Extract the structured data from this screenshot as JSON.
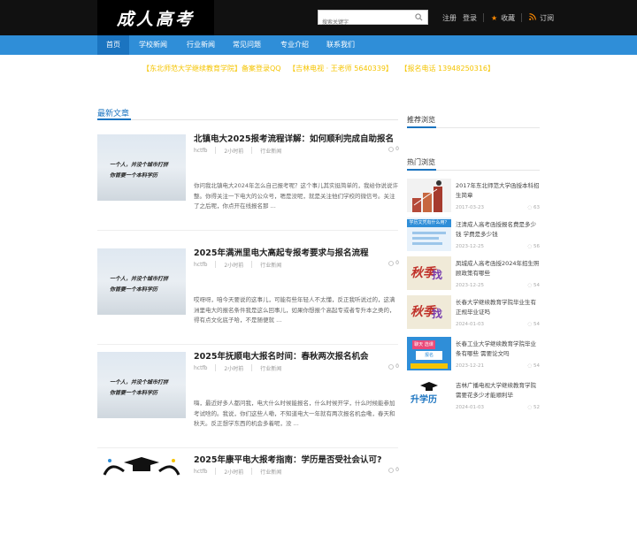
{
  "header": {
    "logo_text": "成人高考",
    "search_placeholder": "搜索关键字",
    "register": "注册",
    "login": "登录",
    "favorite": "收藏",
    "subscribe": "订阅"
  },
  "nav": [
    {
      "label": "首页",
      "active": true
    },
    {
      "label": "学校新闻",
      "active": false
    },
    {
      "label": "行业新闻",
      "active": false
    },
    {
      "label": "常见问题",
      "active": false
    },
    {
      "label": "专业介绍",
      "active": false
    },
    {
      "label": "联系我们",
      "active": false
    }
  ],
  "notice": {
    "part1": "【东北师范大学继续教育学院】备案登录QQ",
    "part2": "【吉林电视 · 王老师 5640339】",
    "part3": "【报名电话 13948250316】"
  },
  "main": {
    "section_title": "最新文章",
    "thumb_line1": "一个人，并没个城市打拼",
    "thumb_line2": "你首要一个本科学历",
    "thumb_highlight": "本科学历",
    "articles": [
      {
        "title": "北镇电大2025报考流程详解：如何顺利完成自助报名",
        "author": "hctfb",
        "time": "2小时前",
        "category": "行业新闻",
        "comments": "0",
        "excerpt": "你问我北镇电大2024年怎么自己报考呢？这个事儿其实挺简单的，我给你说说许整。你得关注一下电大的公众号，嗯是没呢，就是关注他们学校的微信号。关注了之后呢，你点开在线报名那 ..."
      },
      {
        "title": "2025年满洲里电大高起专报考要求与报名流程",
        "author": "hctfb",
        "time": "2小时前",
        "category": "行业新闻",
        "comments": "0",
        "excerpt": "哎呀呀，咱今天要说的这事儿，可能有些年轻人不太懂，反正我听说过的，这满洲里电大的报名条件我是这么回事儿，如果你想报个高起专或者专升本之类的，得有点文化底子哈，不是随便就 ..."
      },
      {
        "title": "2025年抚顺电大报名时间：春秋两次报名机会",
        "author": "hctfb",
        "time": "2小时前",
        "category": "行业新闻",
        "comments": "0",
        "excerpt": "嗨，最近好多人都问我，电大什么时候能报名，什么时候开学，什么时候能参加考试啥的。我说，你们这些人嘞，不知道电大一年就有两次报名机会嘞，春天和秋天。反正想学东西的机会多着呢，没 ..."
      },
      {
        "title": "2025年康平电大报考指南：学历是否受社会认可?",
        "author": "hctfb",
        "time": "2小时前",
        "category": "行业新闻",
        "comments": "0",
        "excerpt": ""
      }
    ]
  },
  "sidebar": {
    "recommend_title": "推荐浏览",
    "hot_title": "热门浏览",
    "hot_items": [
      {
        "title": "2017年东北师范大学函授本科招生简章",
        "date": "2017-03-23",
        "views": "63"
      },
      {
        "title": "汪清成人高考函授报名费是多少钱 学费是多少钱",
        "date": "2023-12-25",
        "views": "56"
      },
      {
        "title": "凤城成人高考函授2024年招生照顾政策有哪些",
        "date": "2023-12-25",
        "views": "54"
      },
      {
        "title": "长春大学继续教育学院毕业生有正规毕业证吗",
        "date": "2024-01-03",
        "views": "54"
      },
      {
        "title": "长春工业大学继续教育学院毕业条有哪些 需要论文吗",
        "date": "2023-12-21",
        "views": "54"
      },
      {
        "title": "吉林广播电视大学继续教育学院需要花多少才能顺利毕",
        "date": "2024-01-03",
        "views": "52"
      }
    ],
    "pic_texts": {
      "banner": "学历文凭有什么用？",
      "chip": "聊天 选课",
      "chip2": "报名",
      "sheng": "升学历"
    }
  },
  "colors": {
    "nav_bg": "#2f8ed8",
    "nav_active": "#1b74c0",
    "accent": "#1b74c0",
    "notice": "#f5c400",
    "star": "#ff8a00"
  }
}
